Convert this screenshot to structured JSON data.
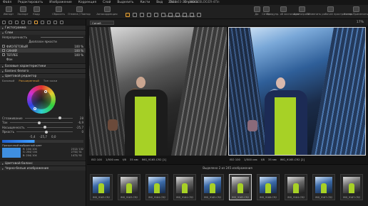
{
  "app": {
    "menu": [
      "Файл",
      "Редактировать",
      "Изображение",
      "Коррекция",
      "Слой",
      "Выделить",
      "Кисти",
      "Вид",
      "Окно",
      "Справка"
    ],
    "title": "2022-03-28 - MODEBLOGER-4Пл"
  },
  "toolbar": {
    "import": "Импорт",
    "export": "Экспорт",
    "loupe": "Кадр",
    "reset": "Сбросить",
    "undo": "Отмена / Повтор",
    "autoadjust": "Автокоррекция",
    "cursor_tools": "Курсоры",
    "tools_label": "Инструменты курсора",
    "right1": "Да",
    "right2": "Сетка",
    "right3": "Предупр. об экспозиции",
    "right4": "Цветопроба",
    "right5": "Изменить рабочее пространство",
    "right6": "Копир.Применить"
  },
  "left": {
    "histogram_section": "Гистограмма",
    "layers_section": "Слои",
    "layer_opacity_label": "Непрозрачность",
    "layers_sub": "Диапазон яркости",
    "layers": [
      {
        "name": "ФИОЛЕТОВЫЙ",
        "value": "100 %"
      },
      {
        "name": "СИНИЙ",
        "value": "100 %"
      },
      {
        "name": "ТЕПЛЕЕ",
        "value": "100 %"
      },
      {
        "name": "Фон",
        "value": ""
      }
    ],
    "basic_section": "Базовые характеристики",
    "wb_section": "Баланс белого",
    "color_editor_section": "Цветовой редактор",
    "color_tabs": [
      "Базовый",
      "Расширенный",
      "Тон кожи"
    ],
    "sliders": [
      {
        "label": "Сглаживание",
        "value": "28"
      },
      {
        "label": "Тон",
        "value": "-6,9"
      },
      {
        "label": "Насыщенность",
        "value": "-25,7"
      },
      {
        "label": "Яркость",
        "value": "0"
      }
    ],
    "lch": {
      "l": "-5,4",
      "c": "-25,7",
      "h": "0,0"
    },
    "pick_label": "Прозрачный выбранный цвет",
    "color_values": [
      "R: 104/ 104",
      "G: 204/ 104",
      "B: 204/ 104"
    ],
    "color_values_right": [
      "2312/ 132",
      "2732/ 31",
      "1472/ 92"
    ],
    "cb_section": "Цветовой баланс",
    "bw_section": "Черно-белые изображение"
  },
  "viewer": {
    "variant_select": "Синий",
    "caption_left": {
      "iso": "ISO 100",
      "shutter": "1/500 сек",
      "aperture": "f/8",
      "focal": "35 мм",
      "file": "IMG_9165.CR2 [1]"
    },
    "caption_right": {
      "iso": "ISO 100",
      "shutter": "1/500 сек",
      "aperture": "f/8",
      "focal": "35 мм",
      "file": "IMG_9165.CR2 [2]"
    },
    "zoom": "17%"
  },
  "filmstrip": {
    "status": "Выделено 2 из 245 изображения",
    "thumbs": [
      {
        "file": "IMG_9163.CR2",
        "selected": false
      },
      {
        "file": "IMG_9163.CR2",
        "selected": false
      },
      {
        "file": "IMG_9164.CR2",
        "selected": false
      },
      {
        "file": "IMG_9164.CR2",
        "selected": false
      },
      {
        "file": "IMG_9165.CR2",
        "selected": false
      },
      {
        "file": "IMG_9165.CR2",
        "selected": true
      },
      {
        "file": "IMG_9166.CR2",
        "selected": false
      },
      {
        "file": "IMG_9164.CR2",
        "selected": false
      },
      {
        "file": "IMG_9167.CR2",
        "selected": false
      },
      {
        "file": "IMG_9167.CR2",
        "selected": false
      }
    ]
  },
  "colors": {
    "accent": "#e6a23a",
    "panel": "#232323",
    "viewer_bg": "#141414"
  }
}
